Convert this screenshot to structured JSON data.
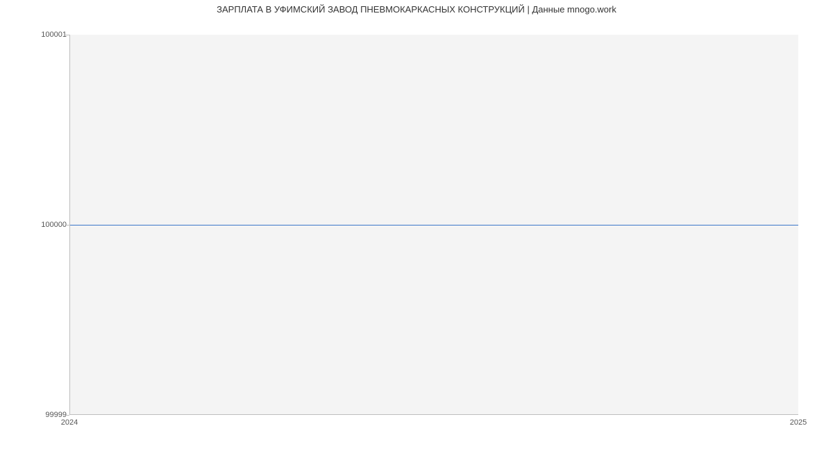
{
  "chart_data": {
    "type": "line",
    "title": "ЗАРПЛАТА В УФИМСКИЙ ЗАВОД ПНЕВМОКАРКАСНЫХ КОНСТРУКЦИЙ | Данные mnogo.work",
    "xlabel": "",
    "ylabel": "",
    "x": [
      2024,
      2025
    ],
    "values": [
      100000,
      100000
    ],
    "xlim": [
      2024,
      2025
    ],
    "ylim": [
      99999,
      100001
    ],
    "x_ticks": [
      "2024",
      "2025"
    ],
    "y_ticks": [
      "99999",
      "100000",
      "100001"
    ],
    "line_color": "#3a76c8",
    "grid": false
  }
}
